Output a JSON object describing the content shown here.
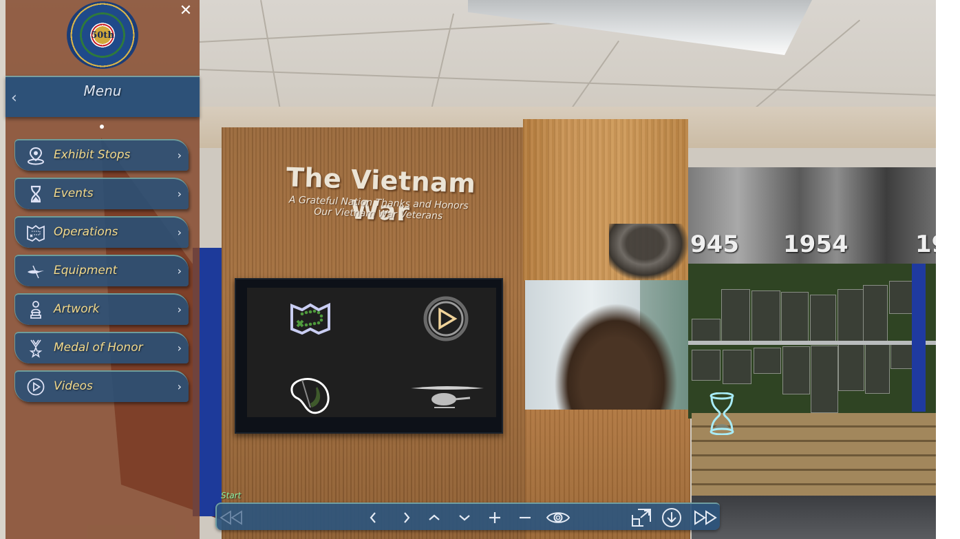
{
  "panel": {
    "logo_text": "50th",
    "logo_name": "The United States of America Vietnam War Commemoration",
    "close_glyph": "✕",
    "header": {
      "title": "Menu",
      "back_glyph": "‹"
    },
    "items": [
      {
        "label": "Exhibit Stops",
        "icon": "map-pin-icon",
        "chevron": "›"
      },
      {
        "label": "Events",
        "icon": "hourglass-icon",
        "chevron": "›"
      },
      {
        "label": "Operations",
        "icon": "map-icon",
        "chevron": "›"
      },
      {
        "label": "Equipment",
        "icon": "helicopter-icon",
        "chevron": "›"
      },
      {
        "label": "Artwork",
        "icon": "bust-icon",
        "chevron": "›"
      },
      {
        "label": "Medal of Honor",
        "icon": "medal-icon",
        "chevron": "›"
      },
      {
        "label": "Videos",
        "icon": "play-circle-icon",
        "chevron": "›"
      }
    ]
  },
  "scene": {
    "wall_title": "The Vietnam War",
    "wall_subtitle_line1": "A Grateful Nation Thanks and Honors",
    "wall_subtitle_line2": "Our Vietnam War Veterans",
    "mural_years": [
      "945",
      "1954",
      "19"
    ],
    "screen_icons": [
      "map-icon",
      "play-icon",
      "helmet-icon",
      "helicopter-icon"
    ],
    "hotspot": "hourglass-icon"
  },
  "toolbar": {
    "start_label": "Start",
    "buttons": [
      {
        "name": "rewind-to-start",
        "icon": "rewind-icon"
      },
      {
        "name": "previous",
        "icon": "chevron-left-icon"
      },
      {
        "name": "next",
        "icon": "chevron-right-icon"
      },
      {
        "name": "look-up",
        "icon": "chevron-up-icon"
      },
      {
        "name": "look-down",
        "icon": "chevron-down-icon"
      },
      {
        "name": "zoom-in",
        "icon": "plus-icon"
      },
      {
        "name": "zoom-out",
        "icon": "minus-icon"
      },
      {
        "name": "toggle-hotspots",
        "icon": "eye-icon"
      },
      {
        "name": "fullscreen",
        "icon": "expand-icon"
      },
      {
        "name": "download",
        "icon": "download-circle-icon"
      },
      {
        "name": "fast-forward-to-end",
        "icon": "fast-forward-icon"
      }
    ]
  }
}
